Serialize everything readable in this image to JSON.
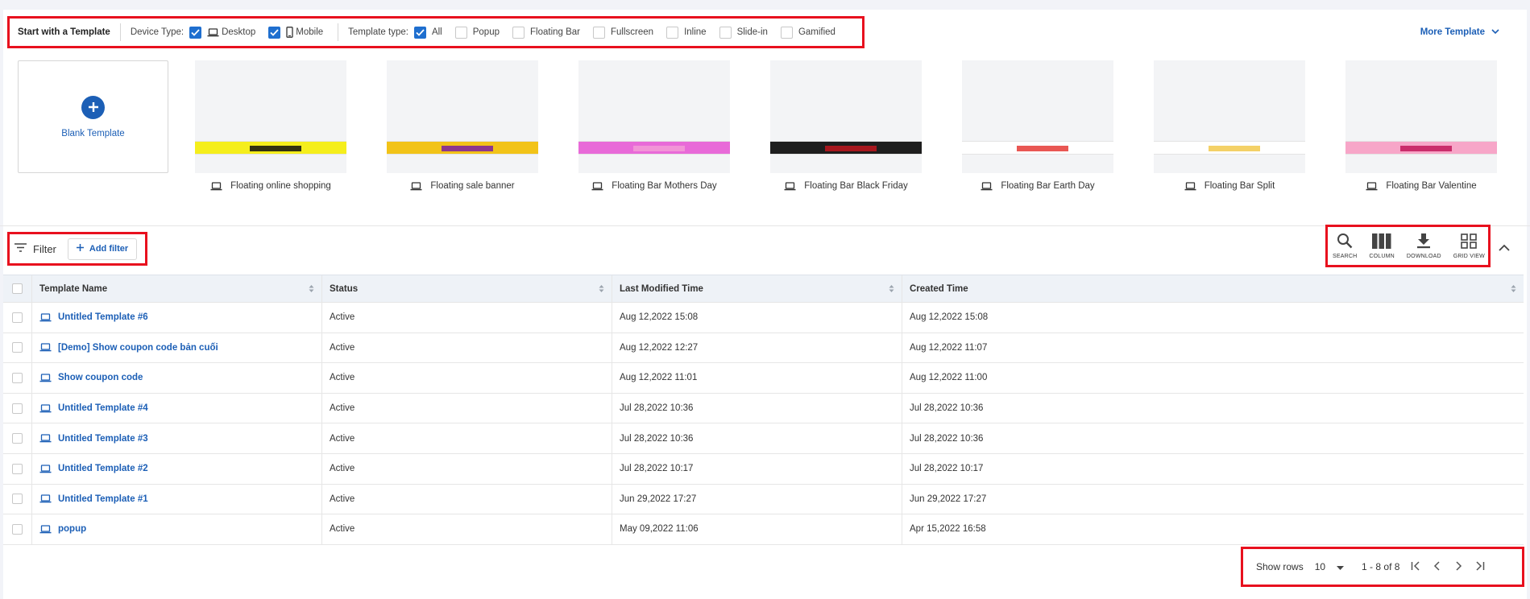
{
  "template_bar": {
    "title": "Start with a Template",
    "device_type_label": "Device Type:",
    "device_options": [
      {
        "label": "Desktop",
        "checked": true,
        "icon": "laptop-icon"
      },
      {
        "label": "Mobile",
        "checked": true,
        "icon": "phone-icon"
      }
    ],
    "template_type_label": "Template type:",
    "type_options": [
      {
        "label": "All",
        "checked": true
      },
      {
        "label": "Popup",
        "checked": false
      },
      {
        "label": "Floating Bar",
        "checked": false
      },
      {
        "label": "Fullscreen",
        "checked": false
      },
      {
        "label": "Inline",
        "checked": false
      },
      {
        "label": "Slide-in",
        "checked": false
      },
      {
        "label": "Gamified",
        "checked": false
      }
    ],
    "more_label": "More Template"
  },
  "blank_template": {
    "label": "Blank Template"
  },
  "templates": [
    {
      "name": "Floating online shopping",
      "band_color": "#f5ee1c",
      "accent": "#111111"
    },
    {
      "name": "Floating sale banner",
      "band_color": "#f2c318",
      "accent": "#7b1fa2"
    },
    {
      "name": "Floating Bar Mothers Day",
      "band_color": "#e86ad8",
      "accent": "#f39bd7"
    },
    {
      "name": "Floating Bar Black Friday",
      "band_color": "#1e1e1e",
      "accent": "#c0161e"
    },
    {
      "name": "Floating Bar Earth Day",
      "band_color": "#ffffff",
      "accent": "#e53935"
    },
    {
      "name": "Floating Bar Split",
      "band_color": "#ffffff",
      "accent": "#f2c94c"
    },
    {
      "name": "Floating Bar Valentine",
      "band_color": "#f7a6c8",
      "accent": "#c2185b"
    }
  ],
  "filter": {
    "label": "Filter",
    "add_label": "Add filter"
  },
  "tools": [
    {
      "label": "SEARCH",
      "icon": "search-icon"
    },
    {
      "label": "COLUMN",
      "icon": "column-icon"
    },
    {
      "label": "DOWNLOAD",
      "icon": "download-icon"
    },
    {
      "label": "GRID VIEW",
      "icon": "grid-view-icon"
    }
  ],
  "table": {
    "columns": [
      "Template Name",
      "Status",
      "Last Modified Time",
      "Created Time"
    ],
    "rows": [
      {
        "name": "Untitled Template #6",
        "status": "Active",
        "modified": "Aug 12,2022 15:08",
        "created": "Aug 12,2022 15:08"
      },
      {
        "name": "[Demo] Show coupon code bản cuối",
        "status": "Active",
        "modified": "Aug 12,2022 12:27",
        "created": "Aug 12,2022 11:07"
      },
      {
        "name": "Show coupon code",
        "status": "Active",
        "modified": "Aug 12,2022 11:01",
        "created": "Aug 12,2022 11:00"
      },
      {
        "name": "Untitled Template #4",
        "status": "Active",
        "modified": "Jul 28,2022 10:36",
        "created": "Jul 28,2022 10:36"
      },
      {
        "name": "Untitled Template #3",
        "status": "Active",
        "modified": "Jul 28,2022 10:36",
        "created": "Jul 28,2022 10:36"
      },
      {
        "name": "Untitled Template #2",
        "status": "Active",
        "modified": "Jul 28,2022 10:17",
        "created": "Jul 28,2022 10:17"
      },
      {
        "name": "Untitled Template #1",
        "status": "Active",
        "modified": "Jun 29,2022 17:27",
        "created": "Jun 29,2022 17:27"
      },
      {
        "name": "popup",
        "status": "Active",
        "modified": "May 09,2022 11:06",
        "created": "Apr 15,2022 16:58"
      }
    ]
  },
  "pager": {
    "show_rows_label": "Show rows",
    "rows_value": "10",
    "range": "1 - 8 of 8"
  },
  "colors": {
    "accent": "#1c5fb6",
    "checkbox": "#1f6fcf",
    "highlight": "#e8101e"
  }
}
